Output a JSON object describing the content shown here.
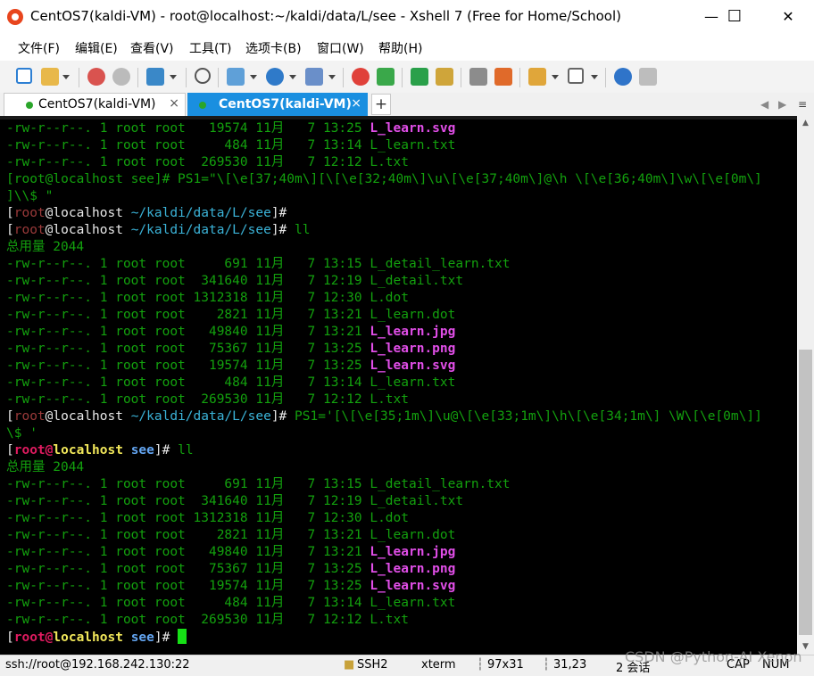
{
  "window": {
    "title": "CentOS7(kaldi-VM) - root@localhost:~/kaldi/data/L/see - Xshell 7 (Free for Home/School)",
    "minimize": "—",
    "maximize": "☐",
    "close": "✕"
  },
  "menu": [
    "文件(F)",
    "编辑(E)",
    "查看(V)",
    "工具(T)",
    "选项卡(B)",
    "窗口(W)",
    "帮助(H)"
  ],
  "tabs": [
    {
      "label": "CentOS7(kaldi-VM)",
      "close": "×"
    },
    {
      "label": "CentOS7(kaldi-VM)",
      "close": "×"
    }
  ],
  "tab_add": "+",
  "tab_nav": [
    "◀",
    "▶",
    "≡"
  ],
  "terminal": {
    "lines": [
      {
        "perm": "-rw-r--r--.",
        "rest": " 1 root root   19574 11月   7 13:25 ",
        "file": "L_learn.svg",
        "type": "img"
      },
      {
        "perm": "-rw-r--r--.",
        "rest": " 1 root root     484 11月   7 13:14 ",
        "file": "L_learn.txt",
        "type": "plain"
      },
      {
        "perm": "-rw-r--r--.",
        "rest": " 1 root root  269530 11月   7 12:12 ",
        "file": "L.txt",
        "type": "plain"
      },
      {
        "raw": "[root@localhost see]# PS1=\"\\[\\e[37;40m\\][\\[\\e[32;40m\\]\\u\\[\\e[37;40m\\]@\\h \\[\\e[36;40m\\]\\w\\[\\e[0m\\]"
      },
      {
        "raw": "]\\\\$ \""
      },
      {
        "p1": "[",
        "p2": "root",
        "p3": "@localhost ",
        "p4": "~/kaldi/data/L/see",
        "p5": "]#",
        "cmd": ""
      },
      {
        "p1": "[",
        "p2": "root",
        "p3": "@localhost ",
        "p4": "~/kaldi/data/L/see",
        "p5": "]#",
        "cmd": " ll"
      },
      {
        "raw": "总用量 2044"
      },
      {
        "perm": "-rw-r--r--.",
        "rest": " 1 root root     691 11月   7 13:15 ",
        "file": "L_detail_learn.txt",
        "type": "plain"
      },
      {
        "perm": "-rw-r--r--.",
        "rest": " 1 root root  341640 11月   7 12:19 ",
        "file": "L_detail.txt",
        "type": "plain"
      },
      {
        "perm": "-rw-r--r--.",
        "rest": " 1 root root 1312318 11月   7 12:30 ",
        "file": "L.dot",
        "type": "plain"
      },
      {
        "perm": "-rw-r--r--.",
        "rest": " 1 root root    2821 11月   7 13:21 ",
        "file": "L_learn.dot",
        "type": "plain"
      },
      {
        "perm": "-rw-r--r--.",
        "rest": " 1 root root   49840 11月   7 13:21 ",
        "file": "L_learn.jpg",
        "type": "img"
      },
      {
        "perm": "-rw-r--r--.",
        "rest": " 1 root root   75367 11月   7 13:25 ",
        "file": "L_learn.png",
        "type": "img"
      },
      {
        "perm": "-rw-r--r--.",
        "rest": " 1 root root   19574 11月   7 13:25 ",
        "file": "L_learn.svg",
        "type": "img"
      },
      {
        "perm": "-rw-r--r--.",
        "rest": " 1 root root     484 11月   7 13:14 ",
        "file": "L_learn.txt",
        "type": "plain"
      },
      {
        "perm": "-rw-r--r--.",
        "rest": " 1 root root  269530 11月   7 12:12 ",
        "file": "L.txt",
        "type": "plain"
      },
      {
        "p1": "[",
        "p2": "root",
        "p3": "@localhost ",
        "p4": "~/kaldi/data/L/see",
        "p5": "]#",
        "cmd": " PS1='[\\[\\e[35;1m\\]\\u@\\[\\e[33;1m\\]\\h\\[\\e[34;1m\\] \\W\\[\\e[0m\\]]"
      },
      {
        "raw": "\\$ '"
      },
      {
        "q1": "[",
        "q2": "root@",
        "q3": "localhost",
        "q4": " see",
        "q5": "]#",
        "cmd": " ll"
      },
      {
        "raw": "总用量 2044"
      },
      {
        "perm": "-rw-r--r--.",
        "rest": " 1 root root     691 11月   7 13:15 ",
        "file": "L_detail_learn.txt",
        "type": "plain"
      },
      {
        "perm": "-rw-r--r--.",
        "rest": " 1 root root  341640 11月   7 12:19 ",
        "file": "L_detail.txt",
        "type": "plain"
      },
      {
        "perm": "-rw-r--r--.",
        "rest": " 1 root root 1312318 11月   7 12:30 ",
        "file": "L.dot",
        "type": "plain"
      },
      {
        "perm": "-rw-r--r--.",
        "rest": " 1 root root    2821 11月   7 13:21 ",
        "file": "L_learn.dot",
        "type": "plain"
      },
      {
        "perm": "-rw-r--r--.",
        "rest": " 1 root root   49840 11月   7 13:21 ",
        "file": "L_learn.jpg",
        "type": "img"
      },
      {
        "perm": "-rw-r--r--.",
        "rest": " 1 root root   75367 11月   7 13:25 ",
        "file": "L_learn.png",
        "type": "img"
      },
      {
        "perm": "-rw-r--r--.",
        "rest": " 1 root root   19574 11月   7 13:25 ",
        "file": "L_learn.svg",
        "type": "img"
      },
      {
        "perm": "-rw-r--r--.",
        "rest": " 1 root root     484 11月   7 13:14 ",
        "file": "L_learn.txt",
        "type": "plain"
      },
      {
        "perm": "-rw-r--r--.",
        "rest": " 1 root root  269530 11月   7 12:12 ",
        "file": "L.txt",
        "type": "plain"
      },
      {
        "q1": "[",
        "q2": "root@",
        "q3": "localhost",
        "q4": " see",
        "q5": "]#",
        "cmd": " ",
        "cursor": true
      }
    ]
  },
  "statusbar": {
    "connection": "ssh://root@192.168.242.130:22",
    "protocol": "SSH2",
    "terminal_type": "xterm",
    "size": "97x31",
    "position": "31,23",
    "sessions": "2 会话",
    "caps": "CAP",
    "num": "NUM"
  },
  "watermark": "CSDN @Python-AI Xenon",
  "colors": {
    "terminal_bg": "#000000",
    "terminal_fg": "#16c60c",
    "image_file": "#e14ee8",
    "active_tab": "#1a8fe0"
  }
}
